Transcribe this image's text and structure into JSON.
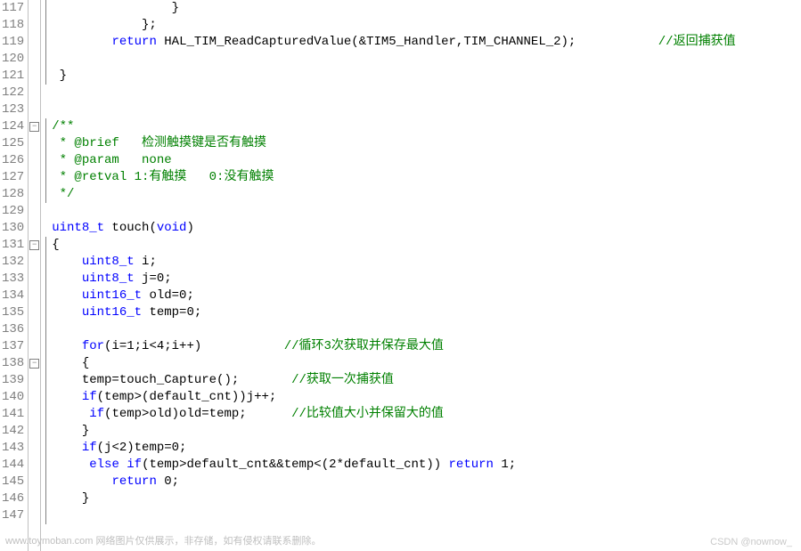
{
  "editor": {
    "first_line": 117,
    "lines": [
      {
        "n": 117,
        "html": "                }"
      },
      {
        "n": 118,
        "html": "            };"
      },
      {
        "n": 119,
        "html": "        <span class='kw'>return</span> HAL_TIM_ReadCapturedValue(&amp;TIM5_Handler,TIM_CHANNEL_2);           <span class='cm'>//返回捕获值</span>"
      },
      {
        "n": 120,
        "html": ""
      },
      {
        "n": 121,
        "html": " }"
      },
      {
        "n": 122,
        "html": ""
      },
      {
        "n": 123,
        "html": ""
      },
      {
        "n": 124,
        "html": "<span class='cm'>/**</span>",
        "fold": "-"
      },
      {
        "n": 125,
        "html": "<span class='cm'> * @brief   检测触摸键是否有触摸</span>"
      },
      {
        "n": 126,
        "html": "<span class='cm'> * @param   none</span>"
      },
      {
        "n": 127,
        "html": "<span class='cm'> * @retval 1:有触摸   0:没有触摸</span>"
      },
      {
        "n": 128,
        "html": "<span class='cm'> */</span>"
      },
      {
        "n": 129,
        "html": ""
      },
      {
        "n": 130,
        "html": "<span class='type'>uint8_t</span> touch(<span class='kw'>void</span>)"
      },
      {
        "n": 131,
        "html": "{",
        "fold": "-"
      },
      {
        "n": 132,
        "html": "    <span class='type'>uint8_t</span> i;"
      },
      {
        "n": 133,
        "html": "    <span class='type'>uint8_t</span> j=0;"
      },
      {
        "n": 134,
        "html": "    <span class='type'>uint16_t</span> old=0;"
      },
      {
        "n": 135,
        "html": "    <span class='type'>uint16_t</span> temp=0;"
      },
      {
        "n": 136,
        "html": ""
      },
      {
        "n": 137,
        "html": "    <span class='kw'>for</span>(i=1;i&lt;4;i++)           <span class='cm'>//循环3次获取并保存最大值</span>"
      },
      {
        "n": 138,
        "html": "    {",
        "fold": "-"
      },
      {
        "n": 139,
        "html": "    temp=touch_Capture();       <span class='cm'>//获取一次捕获值</span>"
      },
      {
        "n": 140,
        "html": "    <span class='kw'>if</span>(temp&gt;(default_cnt))j++;"
      },
      {
        "n": 141,
        "html": "     <span class='kw'>if</span>(temp&gt;old)old=temp;      <span class='cm'>//比较值大小并保留大的值</span>"
      },
      {
        "n": 142,
        "html": "    }"
      },
      {
        "n": 143,
        "html": "    <span class='kw'>if</span>(j&lt;2)temp=0;"
      },
      {
        "n": 144,
        "html": "     <span class='kw'>else</span> <span class='kw'>if</span>(temp&gt;default_cnt&amp;&amp;temp&lt;(2*default_cnt)) <span class='kw'>return</span> 1;"
      },
      {
        "n": 145,
        "html": "        <span class='kw'>return</span> 0;"
      },
      {
        "n": 146,
        "html": "    }"
      },
      {
        "n": 147,
        "html": ""
      }
    ]
  },
  "watermarks": {
    "left": "www.toymoban.com 网络图片仅供展示，非存储，如有侵权请联系删除。",
    "right": "CSDN @nownow_"
  }
}
